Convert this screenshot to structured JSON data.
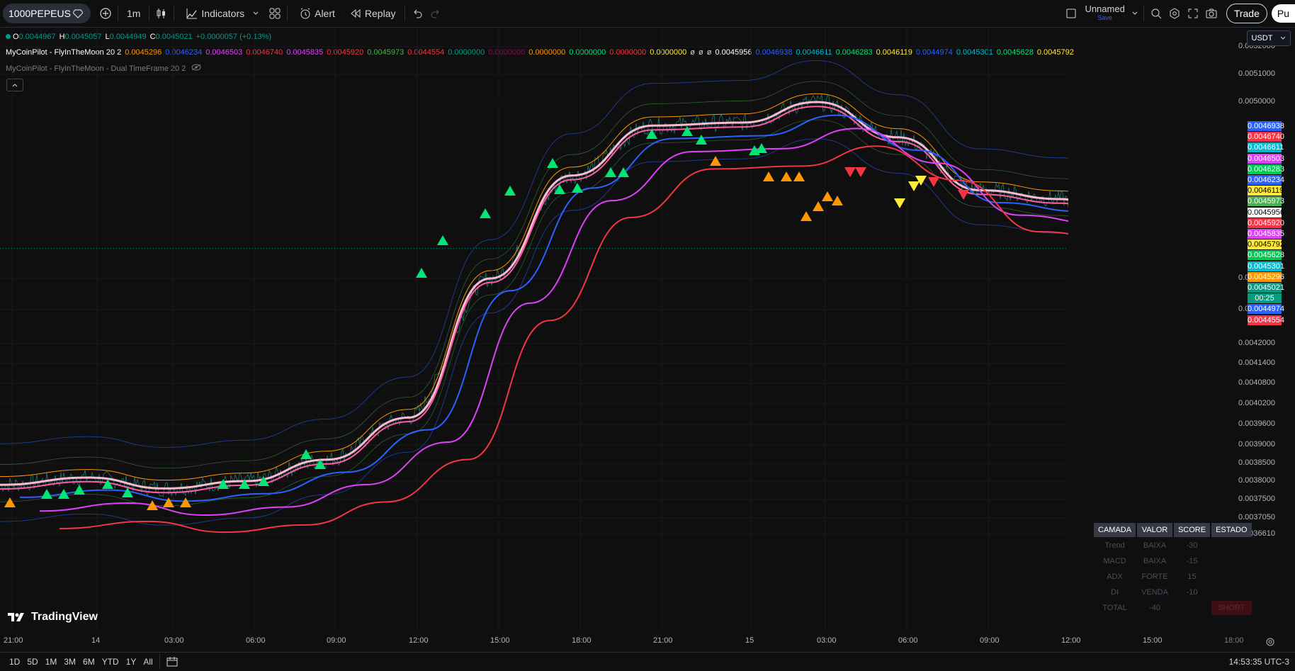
{
  "toolbar": {
    "symbol": "1000PEPEUS",
    "interval": "1m",
    "indicators": "Indicators",
    "alert": "Alert",
    "replay": "Replay",
    "layout_name": "Unnamed",
    "layout_save": "Save",
    "trade": "Trade",
    "publish": "Pu"
  },
  "ohlc": {
    "o_label": "O",
    "o": "0.0044967",
    "h_label": "H",
    "h": "0.0045057",
    "l_label": "L",
    "l": "0.0044949",
    "c_label": "C",
    "c": "0.0045021",
    "chg": "+0.0000057 (+0.13%)"
  },
  "indicator1": {
    "name": "MyCoinPilot - FlyInTheMoon 20 2",
    "values": [
      {
        "v": "0.0045296",
        "color": "#ff9800"
      },
      {
        "v": "0.0046234",
        "color": "#2962ff"
      },
      {
        "v": "0.0046503",
        "color": "#e040fb"
      },
      {
        "v": "0.0046740",
        "color": "#f23645"
      },
      {
        "v": "0.0045835",
        "color": "#e040fb"
      },
      {
        "v": "0.0045920",
        "color": "#f23645"
      },
      {
        "v": "0.0045973",
        "color": "#4caf50"
      },
      {
        "v": "0.0044554",
        "color": "#f23645"
      },
      {
        "v": "0.0000000",
        "color": "#089981"
      },
      {
        "v": "0.0000000",
        "color": "#880e4f"
      },
      {
        "v": "0.0000000",
        "color": "#ff9800"
      },
      {
        "v": "0.0000000",
        "color": "#00e676"
      },
      {
        "v": "0.0000000",
        "color": "#f23645"
      },
      {
        "v": "0.0000000",
        "color": "#ffeb3b"
      },
      {
        "v": "ø",
        "color": "#d1d4dc"
      },
      {
        "v": "ø",
        "color": "#d1d4dc"
      },
      {
        "v": "ø",
        "color": "#d1d4dc"
      },
      {
        "v": "0.0045956",
        "color": "#ffffff"
      },
      {
        "v": "0.0046938",
        "color": "#2962ff"
      },
      {
        "v": "0.0046611",
        "color": "#00bcd4"
      },
      {
        "v": "0.0046283",
        "color": "#00e676"
      },
      {
        "v": "0.0046119",
        "color": "#ffeb3b"
      },
      {
        "v": "0.0044974",
        "color": "#2962ff"
      },
      {
        "v": "0.0045301",
        "color": "#00bcd4"
      },
      {
        "v": "0.0045628",
        "color": "#00e676"
      },
      {
        "v": "0.0045792",
        "color": "#ffeb3b"
      }
    ]
  },
  "indicator2": {
    "name": "MyCoinPilot - FlyInTheMoon - Dual TimeFrame 20 2"
  },
  "currency": "USDT",
  "price_axis": [
    {
      "label": "0.0052000",
      "p": 0.0052
    },
    {
      "label": "0.0051000",
      "p": 0.0051
    },
    {
      "label": "0.0050000",
      "p": 0.005
    },
    {
      "label": "0.0044000",
      "p": 0.0044
    },
    {
      "label": "0.0043000",
      "p": 0.0043
    },
    {
      "label": "0.0042000",
      "p": 0.0042
    },
    {
      "label": "0.0041400",
      "p": 0.00414
    },
    {
      "label": "0.0040800",
      "p": 0.00408
    },
    {
      "label": "0.0040200",
      "p": 0.00402
    },
    {
      "label": "0.0039600",
      "p": 0.00396
    },
    {
      "label": "0.0039000",
      "p": 0.0039
    },
    {
      "label": "0.0038500",
      "p": 0.00385
    },
    {
      "label": "0.0038000",
      "p": 0.0038
    },
    {
      "label": "0.0037500",
      "p": 0.00375
    },
    {
      "label": "0.0037050",
      "p": 0.003705
    },
    {
      "label": "0.0036610",
      "p": 0.003661
    }
  ],
  "price_tags": [
    {
      "label": "0.0046938",
      "color": "#2962ff"
    },
    {
      "label": "0.0046740",
      "color": "#f23645"
    },
    {
      "label": "0.0046611",
      "color": "#00bcd4"
    },
    {
      "label": "0.0046503",
      "color": "#e040fb"
    },
    {
      "label": "0.0046283",
      "color": "#00c853"
    },
    {
      "label": "0.0046234",
      "color": "#2962ff"
    },
    {
      "label": "0.0046119",
      "color": "#ffeb3b"
    },
    {
      "label": "0.0045973",
      "color": "#4caf50"
    },
    {
      "label": "0.0045956",
      "color": "#ffffff"
    },
    {
      "label": "0.0045920",
      "color": "#f23645"
    },
    {
      "label": "0.0045835",
      "color": "#e040fb"
    },
    {
      "label": "0.0045792",
      "color": "#ffeb3b"
    },
    {
      "label": "0.0045628",
      "color": "#00c853"
    },
    {
      "label": "0.0045301",
      "color": "#00bcd4"
    },
    {
      "label": "0.0045296",
      "color": "#ff9800"
    },
    {
      "label": "0.0045021",
      "color": "#089981"
    },
    {
      "label": "00:25",
      "color": "#089981"
    },
    {
      "label": "0.0044974",
      "color": "#2962ff"
    },
    {
      "label": "0.0044554",
      "color": "#f23645"
    }
  ],
  "time_axis": [
    "21:00",
    "14",
    "03:00",
    "06:00",
    "09:00",
    "12:00",
    "15:00",
    "18:00",
    "21:00",
    "15",
    "03:00",
    "06:00",
    "09:00",
    "12:00",
    "15:00",
    "18:00"
  ],
  "ranges": [
    "1D",
    "5D",
    "1M",
    "3M",
    "6M",
    "YTD",
    "1Y",
    "All"
  ],
  "clock": "14:53:35 UTC-3",
  "brand": "TradingView",
  "score_table": {
    "headers": [
      "CAMADA",
      "VALOR",
      "SCORE",
      "ESTADO"
    ],
    "rows": [
      [
        "Trend",
        "BAIXA",
        "-30",
        ""
      ],
      [
        "MACD",
        "BAIXA",
        "-15",
        ""
      ],
      [
        "ADX",
        "FORTE",
        "15",
        ""
      ],
      [
        "DI",
        "VENDA",
        "-10",
        ""
      ],
      [
        "TOTAL",
        "-40",
        "",
        "SHORT"
      ]
    ]
  },
  "chart_data": {
    "type": "line",
    "x": [
      "21:00",
      "14",
      "03:00",
      "06:00",
      "09:00",
      "12:00",
      "15:00",
      "18:00",
      "21:00",
      "15",
      "03:00",
      "06:00",
      "09:00",
      "12:00",
      "15:00"
    ],
    "series": [
      {
        "values": [
          0.00379,
          0.00381,
          0.00378,
          0.0038,
          0.00386,
          0.00398,
          0.0044,
          0.00475,
          0.00492,
          0.00493,
          0.005,
          0.00488,
          0.0047,
          0.00467,
          0.0045
        ]
      }
    ],
    "ylim": [
      0.00365,
      0.00526
    ]
  }
}
